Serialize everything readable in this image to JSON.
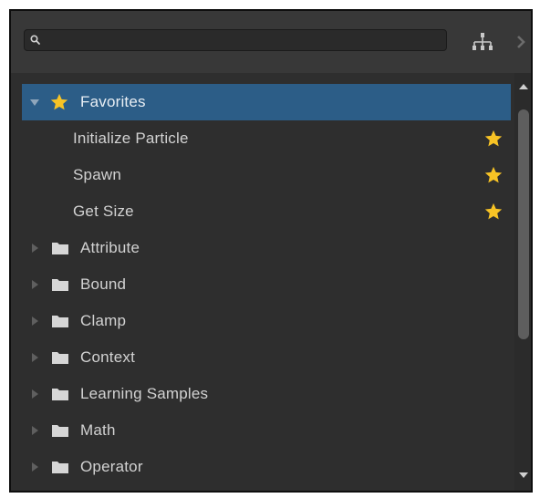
{
  "search": {
    "value": "",
    "placeholder": ""
  },
  "icons": {
    "search": "search-icon",
    "hierarchy": "hierarchy-icon",
    "chevron": "chevron-right-icon",
    "favorite": "star-icon",
    "folder": "folder-icon"
  },
  "colors": {
    "selected_row": "#2c5d87",
    "star": "#f7c325",
    "panel_bg": "#383838",
    "list_bg": "#2e2e2e"
  },
  "tree": {
    "favorites": {
      "label": "Favorites",
      "expanded": true,
      "selected": true,
      "items": [
        {
          "label": "Initialize Particle",
          "favorite": true
        },
        {
          "label": "Spawn",
          "favorite": true
        },
        {
          "label": "Get Size",
          "favorite": true
        }
      ]
    },
    "folders": [
      {
        "label": "Attribute"
      },
      {
        "label": "Bound"
      },
      {
        "label": "Clamp"
      },
      {
        "label": "Context"
      },
      {
        "label": "Learning Samples"
      },
      {
        "label": "Math"
      },
      {
        "label": "Operator"
      }
    ]
  }
}
